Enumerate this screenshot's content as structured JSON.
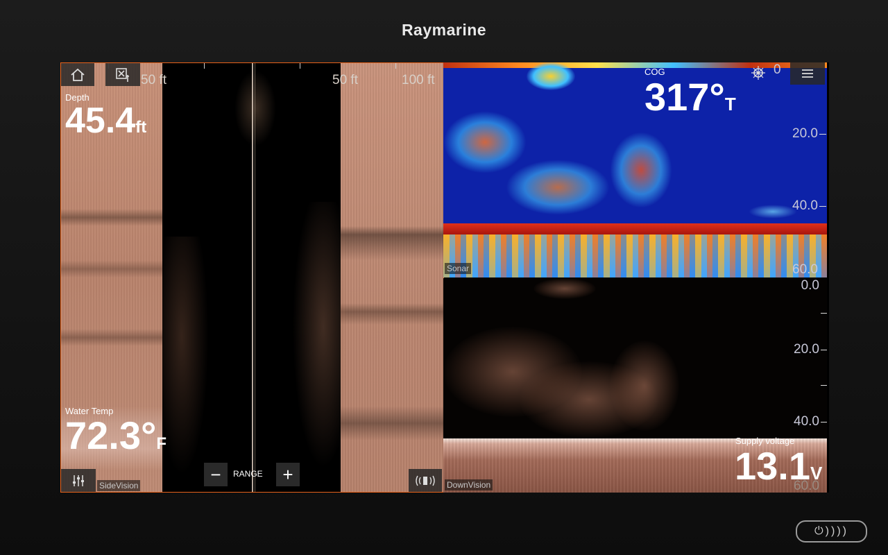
{
  "brand": "Raymarine",
  "colors": {
    "active_pane_border": "#e8621a",
    "sonar_water": "#0d22a8",
    "sidevision_sand": "#c08a72"
  },
  "toolbar": {
    "home_icon": "home-icon",
    "waypoint_icon": "waypoint-icon"
  },
  "sidevision": {
    "tag": "SideVision",
    "scale": {
      "left_50": "50 ft",
      "right_50": "50 ft",
      "right_100": "100 ft"
    },
    "depth": {
      "label": "Depth",
      "value": "45.4",
      "unit": "ft"
    },
    "water_temp": {
      "label": "Water Temp",
      "value": "72.3°",
      "unit": "F"
    },
    "range": {
      "label": "RANGE",
      "minus": "−",
      "plus": "+"
    }
  },
  "sonar": {
    "tag": "Sonar",
    "cog": {
      "label": "COG",
      "value": "317°",
      "unit": "T"
    },
    "depth_scale": [
      "20.0",
      "40.0",
      "60.0"
    ],
    "top_scale": "0"
  },
  "downvision": {
    "tag": "DownVision",
    "depth_scale": [
      "0.0",
      "20.0",
      "40.0",
      "60.0"
    ],
    "supply_voltage": {
      "label": "Supply voltage",
      "value": "13.1",
      "unit": "V"
    }
  },
  "power_glyphs": "⏻))))"
}
